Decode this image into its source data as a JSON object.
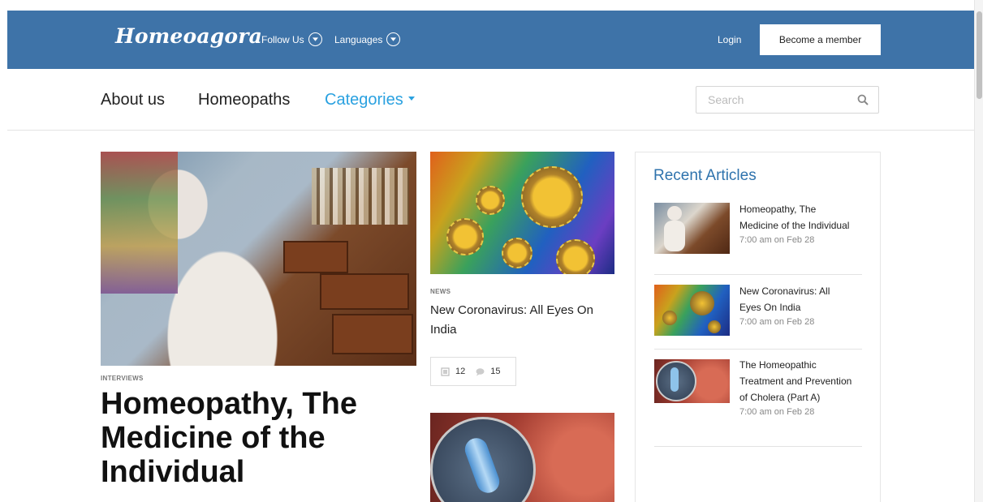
{
  "header": {
    "logo": "Homeoagora",
    "follow_us": "Follow Us",
    "languages": "Languages",
    "login": "Login",
    "become_member": "Become a member"
  },
  "nav": {
    "about": "About us",
    "homeopaths": "Homeopaths",
    "categories": "Categories",
    "search_placeholder": "Search"
  },
  "featured": {
    "category": "INTERVIEWS",
    "title": "Homeopathy, The Medicine of the Individual"
  },
  "news": {
    "category": "NEWS",
    "title": "New Coronavirus: All Eyes On India",
    "views": "12",
    "comments": "15"
  },
  "sidebar": {
    "title": "Recent Articles",
    "items": [
      {
        "title": "Homeopathy, The Medicine of the Individual",
        "time": "7:00 am on Feb 28"
      },
      {
        "title": "New Coronavirus: All Eyes On India",
        "time": "7:00 am on Feb 28"
      },
      {
        "title": "The Homeopathic Treatment and Prevention of Cholera (Part A)",
        "time": "7:00 am on Feb 28"
      }
    ]
  },
  "colors": {
    "header_bg": "#3e73a8",
    "accent": "#2aa1e0",
    "sidebar_title": "#2f73ad"
  }
}
